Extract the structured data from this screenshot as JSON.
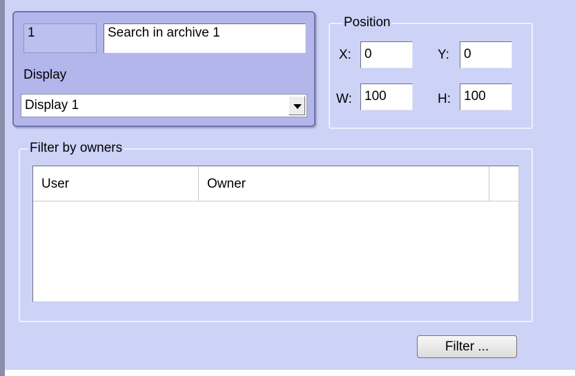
{
  "identity": {
    "id_value": "1",
    "name_value": "Search in archive 1"
  },
  "display": {
    "label": "Display",
    "selected": "Display 1"
  },
  "position": {
    "legend": "Position",
    "x_label": "X:",
    "x_value": "0",
    "y_label": "Y:",
    "y_value": "0",
    "w_label": "W:",
    "w_value": "100",
    "h_label": "H:",
    "h_value": "100"
  },
  "filter": {
    "legend": "Filter by owners",
    "columns": [
      "User",
      "Owner"
    ],
    "rows": [],
    "button_label": "Filter ..."
  },
  "colors": {
    "background": "#cdd3f7",
    "identity_panel": "#b2b6ea"
  }
}
